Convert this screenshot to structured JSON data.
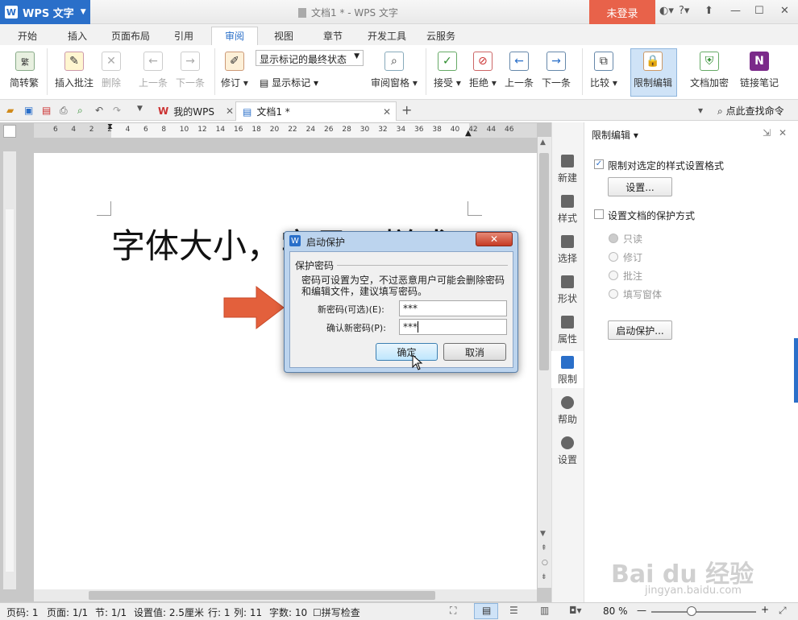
{
  "app": {
    "name": "WPS 文字",
    "doc_title": "文档1 * - WPS 文字",
    "login": "未登录"
  },
  "menu": {
    "tabs": [
      "开始",
      "插入",
      "页面布局",
      "引用",
      "审阅",
      "视图",
      "章节",
      "开发工具",
      "云服务"
    ],
    "active": "审阅"
  },
  "ribbon": {
    "partial_left": "简转繁",
    "insert_comment": "插入批注",
    "delete": "删除",
    "prev": "上一条",
    "next": "下一条",
    "revise": "修订",
    "markup_select": "显示标记的最终状态",
    "show_markup": "显示标记",
    "review_pane": "审阅窗格",
    "accept": "接受",
    "reject": "拒绝",
    "prev_change": "上一条",
    "next_change": "下一条",
    "compare": "比较",
    "restrict_edit": "限制编辑",
    "encrypt": "文档加密",
    "link_notes": "链接笔记"
  },
  "quickbar": {
    "tab_mywps": "我的WPS",
    "tab_doc": "文档1 *",
    "find_cmd": "点此查找命令"
  },
  "ruler": {
    "ticks": [
      "6",
      "4",
      "2",
      "2",
      "4",
      "6",
      "8",
      "10",
      "12",
      "14",
      "16",
      "18",
      "20",
      "22",
      "24",
      "26",
      "28",
      "30",
      "32",
      "34",
      "36",
      "38",
      "40",
      "42",
      "44",
      "46"
    ]
  },
  "document": {
    "heading": "字体大小，字号，样式"
  },
  "sidebar": {
    "items": [
      "新建",
      "样式",
      "选择",
      "形状",
      "属性",
      "限制",
      "帮助",
      "设置"
    ]
  },
  "panel": {
    "title": "限制编辑",
    "opt1": "限制对选定的样式设置格式",
    "settings_btn": "设置...",
    "opt2": "设置文档的保护方式",
    "radios": [
      "只读",
      "修订",
      "批注",
      "填写窗体"
    ],
    "start_btn": "启动保护..."
  },
  "dialog": {
    "title": "启动保护",
    "group": "保护密码",
    "desc1": "密码可设置为空，不过恶意用户可能会删除密码",
    "desc2": "和编辑文件，建议填写密码。",
    "new_pw_label": "新密码(可选)(E):",
    "new_pw_value": "***",
    "confirm_label": "确认新密码(P):",
    "confirm_value": "***",
    "ok": "确定",
    "cancel": "取消"
  },
  "status": {
    "page": "页码: 1",
    "pages": "页面: 1/1",
    "section": "节: 1/1",
    "setting": "设置值: 2.5厘米",
    "row": "行: 1",
    "col": "列: 11",
    "words": "字数: 10",
    "spell": "拼写检查",
    "zoom": "80 %"
  },
  "watermark": {
    "brand": "Bai du 经验",
    "url": "jingyan.baidu.com"
  }
}
